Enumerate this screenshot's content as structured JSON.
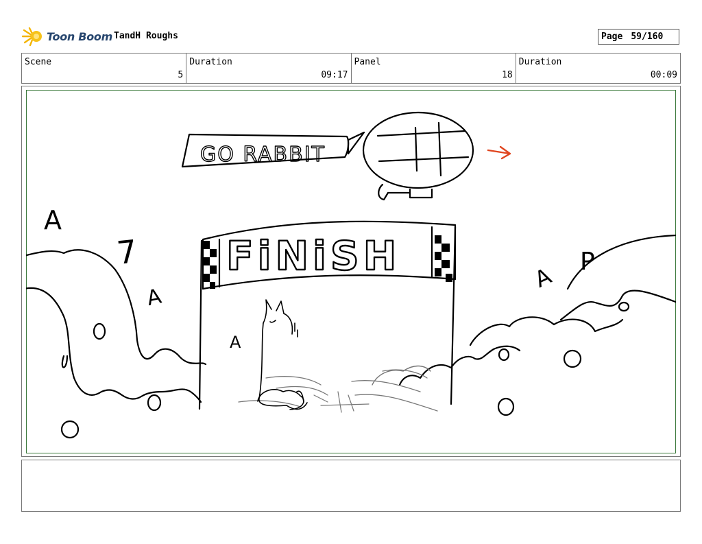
{
  "header": {
    "logo_text": "Toon Boom",
    "project_title": "TandH Roughs",
    "page_label": "Page",
    "page_value": "59/160"
  },
  "info": [
    {
      "label": "Scene",
      "value": "5"
    },
    {
      "label": "Duration",
      "value": "09:17"
    },
    {
      "label": "Panel",
      "value": "18"
    },
    {
      "label": "Duration",
      "value": "00:09"
    }
  ],
  "sketch": {
    "banner_text": "GO RABBIT",
    "finish_text": "FiNiSH",
    "sign_letters": [
      "A",
      "7",
      "A",
      "A",
      "A",
      "P"
    ],
    "arrow_color": "#e0451f",
    "frame_color": "#3c7a3c"
  },
  "notes": ""
}
